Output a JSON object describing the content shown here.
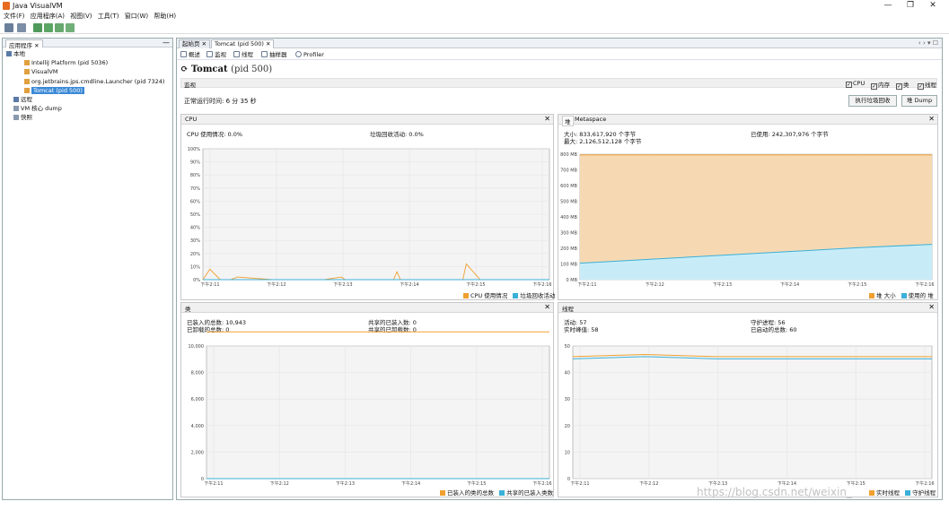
{
  "app": {
    "title": "Java VisualVM",
    "win_min": "—",
    "win_max": "❐",
    "win_close": "✕"
  },
  "menu": [
    "文件(F)",
    "应用程序(A)",
    "视图(V)",
    "工具(T)",
    "窗口(W)",
    "帮助(H)"
  ],
  "left": {
    "tab": "应用程序 ✕",
    "min": "—",
    "tree": [
      {
        "label": "本地",
        "indent": 0,
        "selected": false
      },
      {
        "label": "IntelliJ Platform (pid 5036)",
        "indent": 2,
        "selected": false
      },
      {
        "label": "VisualVM",
        "indent": 2,
        "selected": false
      },
      {
        "label": "org.jetbrains.jps.cmdline.Launcher (pid 7324)",
        "indent": 2,
        "selected": false
      },
      {
        "label": "Tomcat (pid 500)",
        "indent": 2,
        "selected": true
      },
      {
        "label": "远程",
        "indent": 0,
        "selected": false
      },
      {
        "label": "VM 核心 dump",
        "indent": 0,
        "selected": false
      },
      {
        "label": "快照",
        "indent": 0,
        "selected": false
      }
    ]
  },
  "tabs": [
    {
      "label": "起始页 ✕",
      "active": false
    },
    {
      "label": "Tomcat (pid 500) ✕",
      "active": true
    }
  ],
  "nav": "‹ › ▾ ☐",
  "subtabs": [
    "概述",
    "监视",
    "线程",
    "抽样器",
    "Profiler"
  ],
  "page": {
    "title": "Tomcat",
    "pid": "(pid 500)",
    "section": "监视",
    "checks": [
      "CPU",
      "内存",
      "类",
      "线程"
    ],
    "uptime": "正常运行时间: 6 分 35 秒",
    "gc_button": "执行垃圾回收",
    "dump_button": "堆 Dump"
  },
  "colors": {
    "orange": "#f0a030",
    "blue": "#3ab0d8",
    "heapfill": "#f6d9b3",
    "usedfill": "#c8ecf7"
  },
  "cpu": {
    "title": "CPU",
    "info1": "CPU 使用情况: 0.0%",
    "info2": "垃圾回收活动: 0.0%",
    "legend": [
      "CPU 使用情况",
      "垃圾回收活动"
    ],
    "chart_data": {
      "type": "line",
      "ylabels": [
        "100%",
        "90%",
        "80%",
        "70%",
        "60%",
        "50%",
        "40%",
        "30%",
        "20%",
        "10%",
        "0%"
      ],
      "xlabels": [
        "下午2:11",
        "下午2:12",
        "下午2:13",
        "下午2:14",
        "下午2:15",
        "下午2:16"
      ],
      "series": [
        {
          "name": "CPU 使用情况",
          "x": [
            0,
            0.02,
            0.05,
            0.08,
            0.1,
            0.2,
            0.3,
            0.35,
            0.4,
            0.41,
            0.5,
            0.55,
            0.56,
            0.57,
            0.6,
            0.7,
            0.75,
            0.76,
            0.8,
            0.9,
            1
          ],
          "y": [
            0,
            8,
            0,
            0,
            2,
            0,
            0,
            0,
            2,
            0,
            0,
            0,
            6,
            0,
            0,
            0,
            0,
            12,
            0,
            0,
            0
          ]
        }
      ]
    }
  },
  "heap": {
    "title": "堆",
    "title2": "Metaspace",
    "info1": "大小: 833,617,920 个字节",
    "info2": "最大: 2,126,512,128 个字节",
    "info3": "已使用: 242,307,976 个字节",
    "legend": [
      "堆 大小",
      "使用的 堆"
    ],
    "chart_data": {
      "type": "area",
      "ylabels": [
        "800 MB",
        "700 MB",
        "600 MB",
        "500 MB",
        "400 MB",
        "300 MB",
        "200 MB",
        "100 MB",
        "0 MB"
      ],
      "xlabels": [
        "下午2:11",
        "下午2:12",
        "下午2:13",
        "下午2:14",
        "下午2:15",
        "下午2:16"
      ],
      "series": [
        {
          "name": "堆 大小",
          "y": [
            795,
            795,
            795,
            795,
            795,
            795
          ]
        },
        {
          "name": "使用的 堆",
          "y": [
            105,
            130,
            155,
            180,
            205,
            225
          ]
        }
      ]
    }
  },
  "classes": {
    "title": "类",
    "info1": "已装入的总数: 10,943",
    "info2": "已卸载的总数: 0",
    "info3": "共享的已装入数: 0",
    "info4": "共享的已卸载数: 0",
    "legend": [
      "已装入的类的总数",
      "共享的已装入类数"
    ],
    "chart_data": {
      "type": "line",
      "ylabels": [
        "10,000",
        "8,000",
        "6,000",
        "4,000",
        "2,000",
        "0"
      ],
      "xlabels": [
        "下午2:11",
        "下午2:12",
        "下午2:13",
        "下午2:14",
        "下午2:15",
        "下午2:16"
      ],
      "series": [
        {
          "name": "已装入的类的总数",
          "y": [
            10943,
            10943,
            10943,
            10943,
            10943,
            10943
          ]
        },
        {
          "name": "共享的已装入类数",
          "y": [
            0,
            0,
            0,
            0,
            0,
            0
          ]
        }
      ]
    }
  },
  "threads": {
    "title": "线程",
    "info1": "活动: 57",
    "info2": "实时峰值: 58",
    "info3": "守护进程: 56",
    "info4": "已启动的总数: 60",
    "legend": [
      "实时线程",
      "守护线程"
    ],
    "chart_data": {
      "type": "line",
      "ylabels": [
        "50",
        "40",
        "30",
        "20",
        "10",
        "0"
      ],
      "xlabels": [
        "下午2:11",
        "下午2:12",
        "下午2:13",
        "下午2:14",
        "下午2:15",
        "下午2:16"
      ],
      "series": [
        {
          "name": "实时线程",
          "y": [
            57,
            58,
            57,
            57,
            57,
            57
          ]
        },
        {
          "name": "守护线程",
          "y": [
            56,
            57,
            56,
            56,
            56,
            56
          ]
        }
      ]
    }
  },
  "watermark": "https://blog.csdn.net/weixin_"
}
